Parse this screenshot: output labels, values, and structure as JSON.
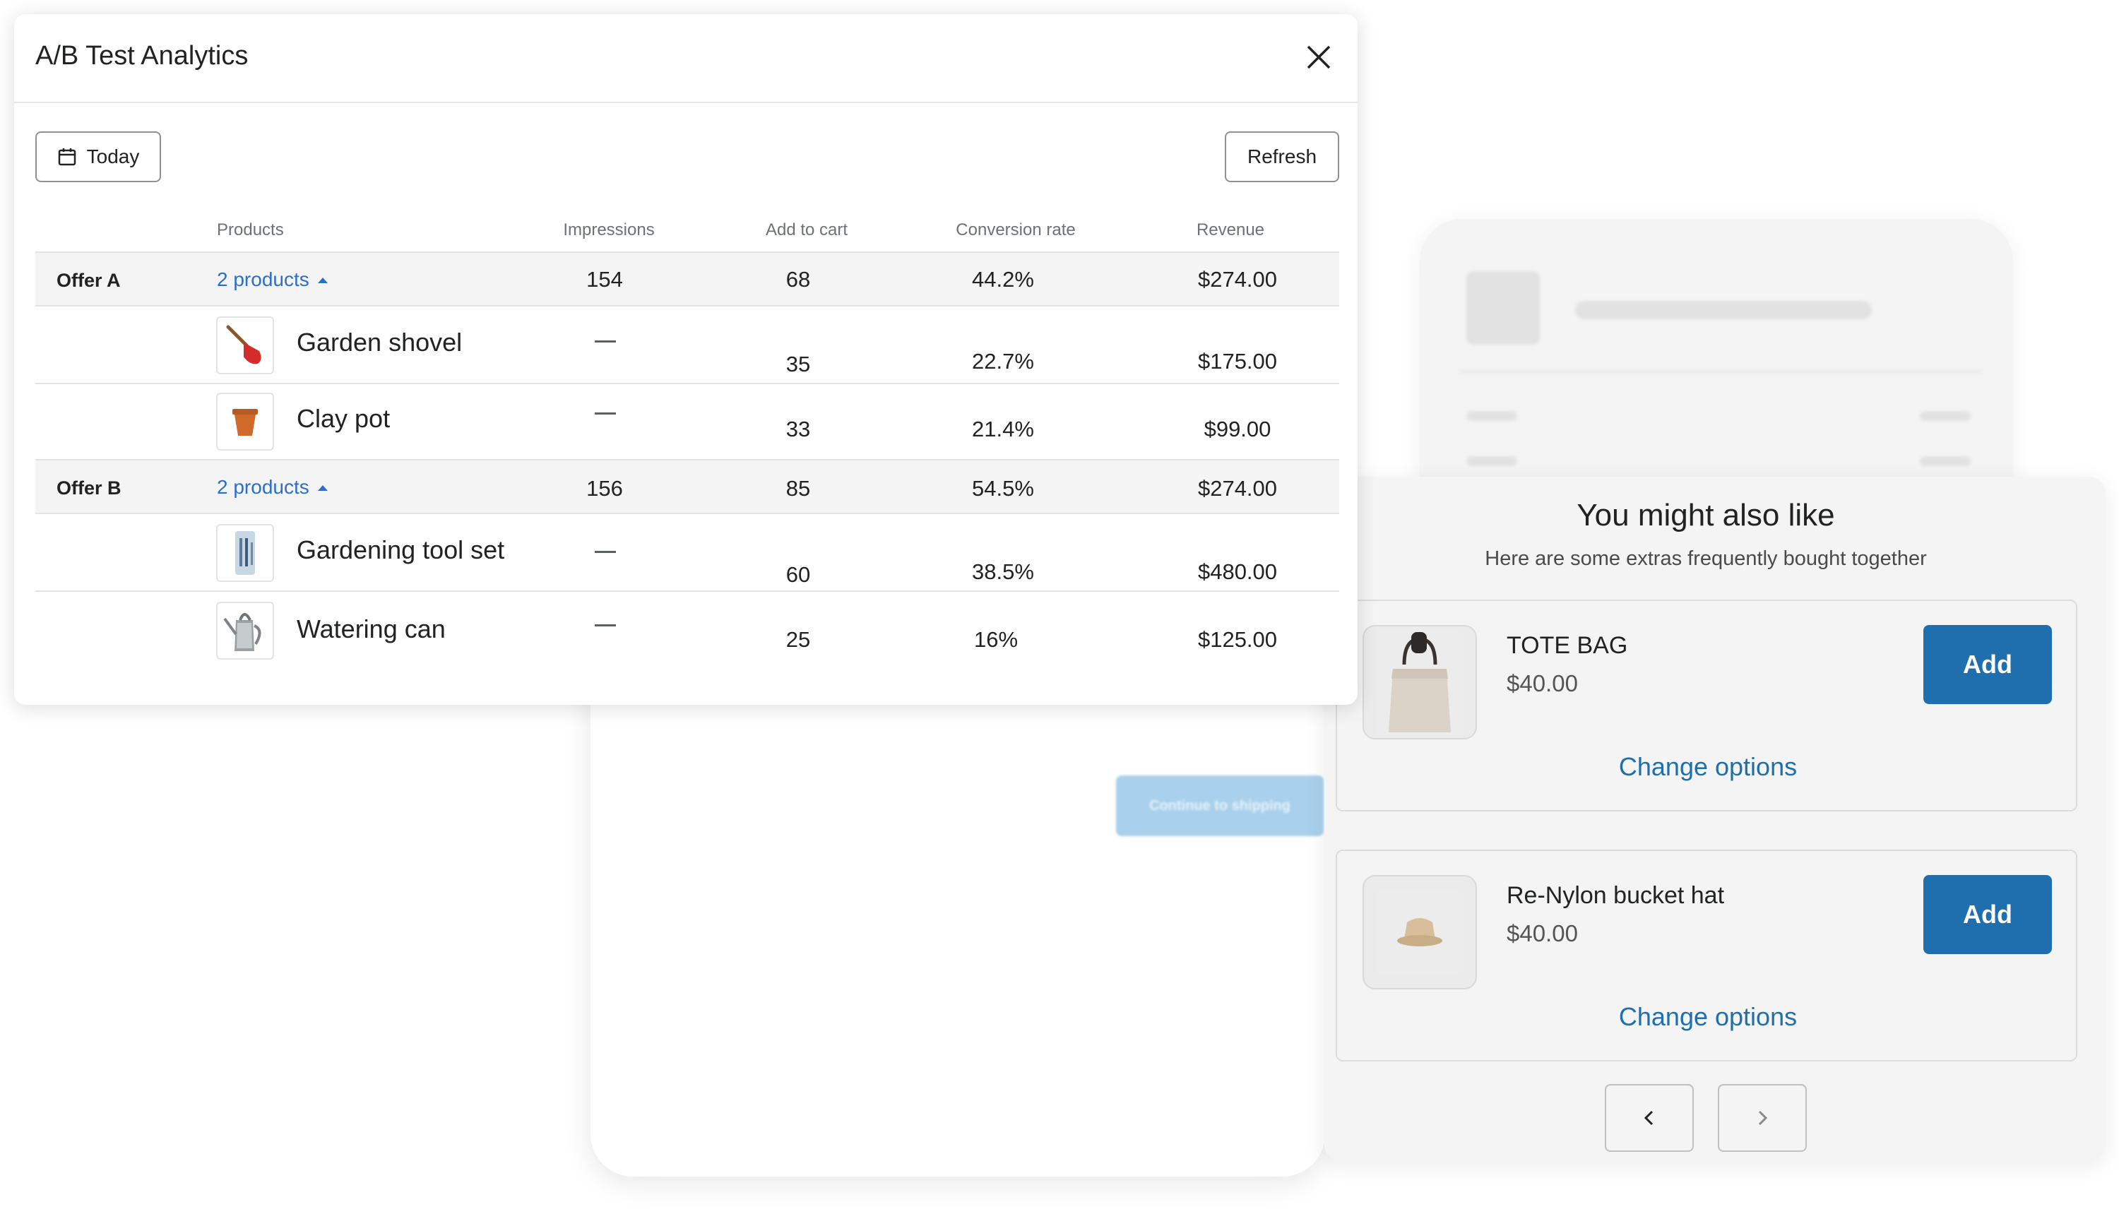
{
  "modal": {
    "title": "A/B Test Analytics",
    "date_button": "Today",
    "refresh_button": "Refresh",
    "columns": [
      "Products",
      "Impressions",
      "Add to cart",
      "Conversion rate",
      "Revenue"
    ],
    "offers": [
      {
        "label": "Offer A",
        "products_link": "2 products",
        "impressions": "154",
        "add_to_cart": "68",
        "conversion_rate": "44.2%",
        "revenue": "$274.00",
        "products": [
          {
            "name": "Garden shovel",
            "impressions": "—",
            "add_to_cart": "35",
            "conversion_rate": "22.7%",
            "revenue": "$175.00",
            "icon": "shovel-icon"
          },
          {
            "name": "Clay pot",
            "impressions": "—",
            "add_to_cart": "33",
            "conversion_rate": "21.4%",
            "revenue": "$99.00",
            "icon": "clay-pot-icon"
          }
        ]
      },
      {
        "label": "Offer B",
        "products_link": "2 products",
        "impressions": "156",
        "add_to_cart": "85",
        "conversion_rate": "54.5%",
        "revenue": "$274.00",
        "products": [
          {
            "name": "Gardening tool set",
            "impressions": "—",
            "add_to_cart": "60",
            "conversion_rate": "38.5%",
            "revenue": "$480.00",
            "icon": "tool-set-icon"
          },
          {
            "name": "Watering can",
            "impressions": "—",
            "add_to_cart": "25",
            "conversion_rate": "16%",
            "revenue": "$125.00",
            "icon": "watering-can-icon"
          }
        ]
      }
    ]
  },
  "checkout": {
    "continue_button": "Continue to shipping"
  },
  "upsell": {
    "title": "You might also like",
    "subtitle": "Here are some extras frequently bought together",
    "items": [
      {
        "name": "TOTE BAG",
        "price": "$40.00",
        "add_label": "Add",
        "change_label": "Change options",
        "icon": "tote-bag-icon"
      },
      {
        "name": "Re-Nylon bucket hat",
        "price": "$40.00",
        "add_label": "Add",
        "change_label": "Change options",
        "icon": "bucket-hat-icon"
      }
    ]
  },
  "colors": {
    "accent": "#1f6ead",
    "link": "#2c6ecb",
    "row_highlight": "#f4f4f4"
  }
}
